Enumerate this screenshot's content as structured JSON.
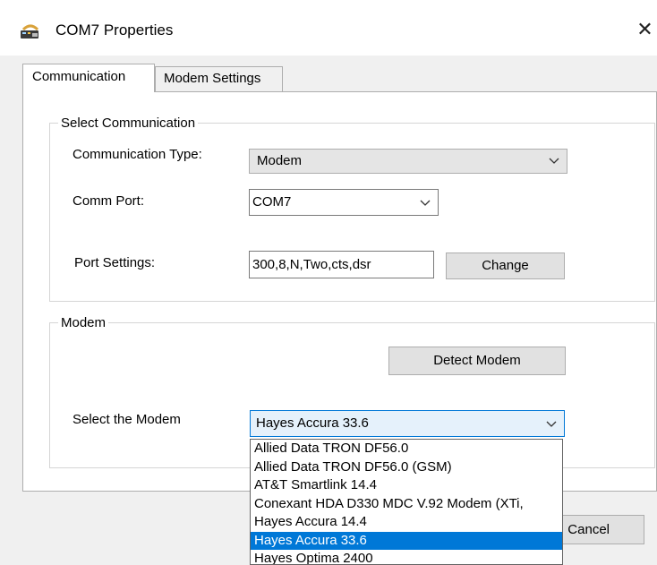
{
  "window": {
    "title": "COM7 Properties",
    "close_glyph": "✕"
  },
  "tabs": [
    {
      "label": "Communication",
      "active": true
    },
    {
      "label": "Modem Settings",
      "active": false
    }
  ],
  "select_communication": {
    "group_label": "Select Communication",
    "communication_type_label": "Communication Type:",
    "communication_type_value": "Modem",
    "comm_port_label": "Comm Port:",
    "comm_port_value": "COM7",
    "port_settings_label": "Port Settings:",
    "port_settings_value": "300,8,N,Two,cts,dsr",
    "change_button": "Change"
  },
  "modem": {
    "group_label": "Modem",
    "detect_button": "Detect Modem",
    "select_label": "Select the Modem",
    "selected_modem": "Hayes Accura 33.6",
    "options": [
      "Allied Data TRON DF56.0",
      "Allied Data TRON DF56.0 (GSM)",
      "AT&T Smartlink 14.4",
      "Conexant HDA D330 MDC V.92 Modem (XTi,",
      "Hayes Accura 14.4",
      "Hayes Accura 33.6",
      "Hayes Optima 2400"
    ],
    "highlighted_index": 5
  },
  "footer": {
    "cancel_button": "Cancel"
  },
  "colors": {
    "selection": "#0078d7",
    "dialog_bg": "#f0f0f0",
    "panel_bg": "#ffffff"
  },
  "icons": {
    "app": "modem-phone-icon",
    "chevron": "chevron-down-icon"
  }
}
